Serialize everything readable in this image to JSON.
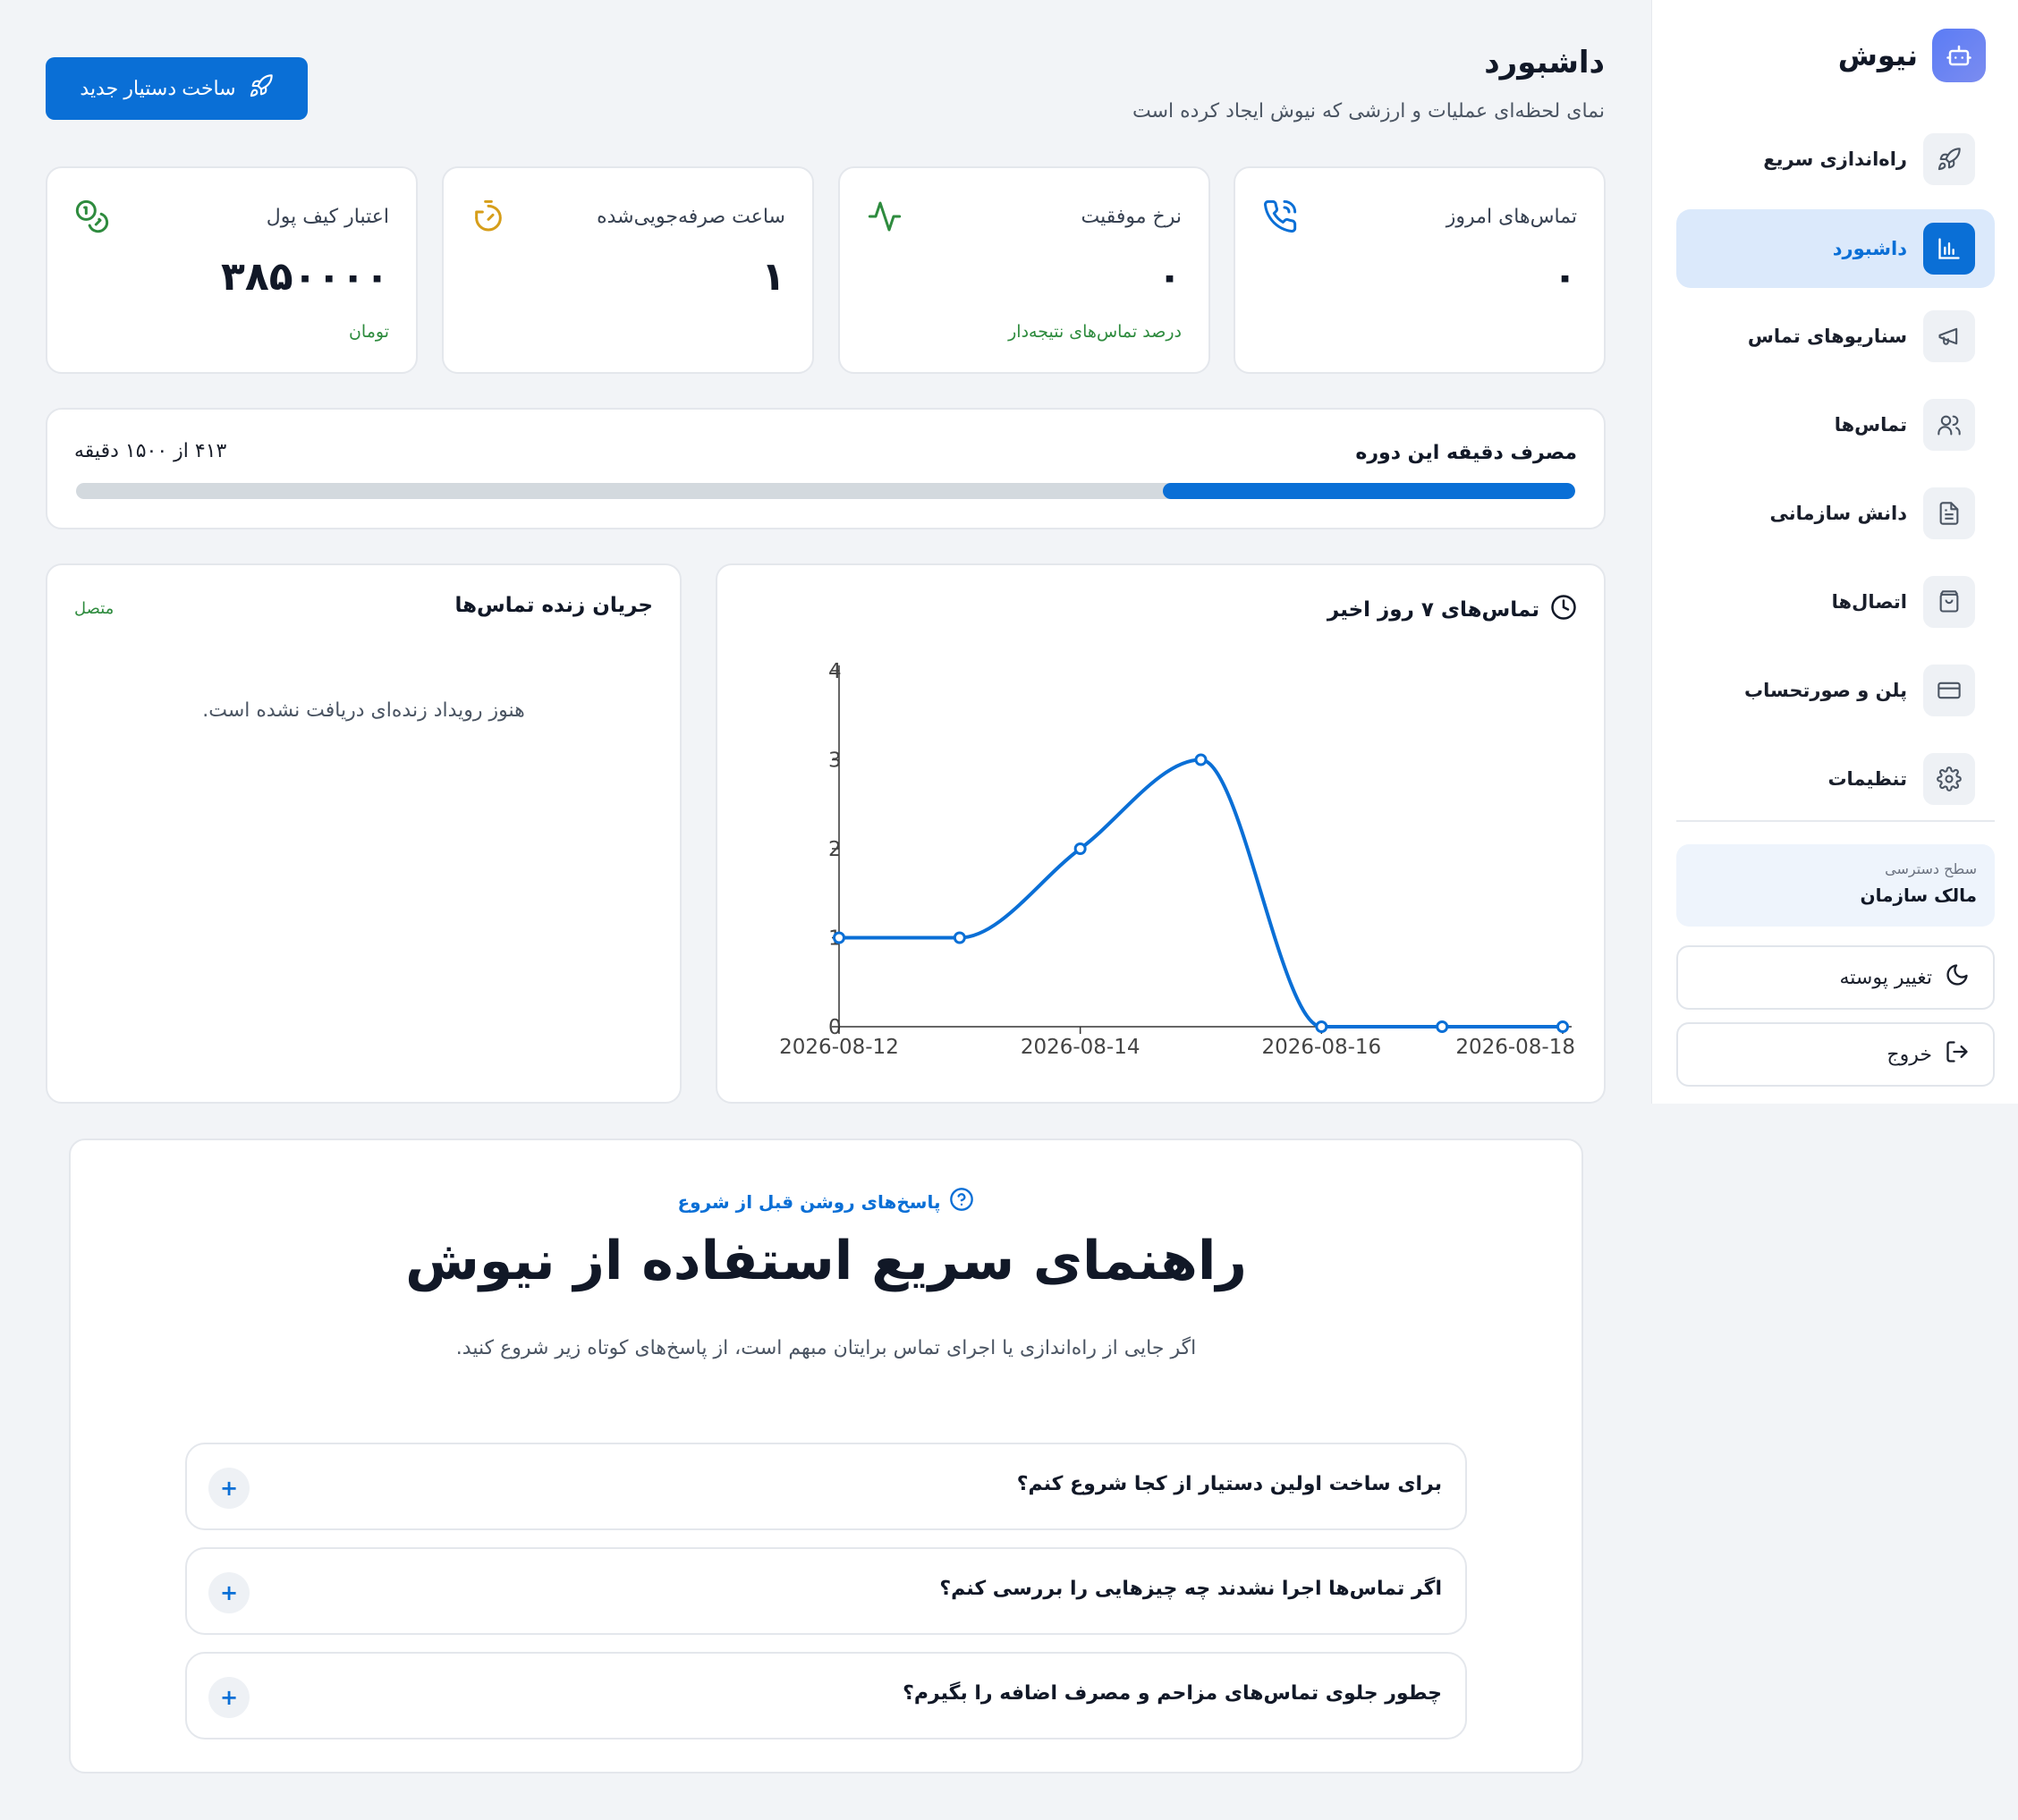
{
  "brand": {
    "name": "نیوش"
  },
  "sidebar": {
    "items": [
      {
        "label": "راه‌اندازی سریع",
        "icon": "rocket-icon",
        "active": false
      },
      {
        "label": "داشبورد",
        "icon": "bar-chart-icon",
        "active": true
      },
      {
        "label": "سناریوهای تماس",
        "icon": "megaphone-icon",
        "active": false
      },
      {
        "label": "تماس‌ها",
        "icon": "users-icon",
        "active": false
      },
      {
        "label": "دانش سازمانی",
        "icon": "document-icon",
        "active": false
      },
      {
        "label": "اتصال‌ها",
        "icon": "bag-icon",
        "active": false
      },
      {
        "label": "پلن و صورتحساب",
        "icon": "credit-card-icon",
        "active": false
      },
      {
        "label": "تنظیمات",
        "icon": "gear-icon",
        "active": false
      }
    ],
    "access": {
      "caption": "سطح دسترسی",
      "value": "مالک سازمان"
    },
    "theme_button": "تغییر پوسته",
    "logout_button": "خروج"
  },
  "header": {
    "title": "داشبورد",
    "subtitle": "نمای لحظه‌ای عملیات و ارزشی که نیوش ایجاد کرده است",
    "create_button": "ساخت دستیار جدید"
  },
  "stats": [
    {
      "title": "تماس‌های امروز",
      "value": "۰",
      "foot": "",
      "icon": "phone-icon"
    },
    {
      "title": "نرخ موفقیت",
      "value": "۰",
      "foot": "درصد تماس‌های نتیجه‌دار",
      "icon": "activity-icon"
    },
    {
      "title": "ساعت صرفه‌جویی‌شده",
      "value": "۱",
      "foot": "",
      "icon": "timer-icon"
    },
    {
      "title": "اعتبار کیف پول",
      "value": "۳۸۵۰۰۰۰",
      "foot": "تومان",
      "icon": "coins-icon"
    }
  ],
  "usage": {
    "title": "مصرف دقیقه این دوره",
    "count_text": "۴۱۳ از ۱۵۰۰ دقیقه",
    "used": 413,
    "total": 1500
  },
  "live_feed": {
    "title": "جریان زنده تماس‌ها",
    "status": "متصل",
    "empty_text": "هنوز رویداد زنده‌ای دریافت نشده است."
  },
  "chart_panel": {
    "title": "تماس‌های ۷ روز اخیر"
  },
  "chart_data": {
    "type": "line",
    "title": "تماس‌های ۷ روز اخیر",
    "x": [
      "2026-08-12",
      "2026-08-13",
      "2026-08-14",
      "2026-08-15",
      "2026-08-16",
      "2026-08-17",
      "2026-08-18"
    ],
    "x_tick_labels": [
      "2026-08-12",
      "2026-08-14",
      "2026-08-16",
      "2026-08-18"
    ],
    "values": [
      1,
      1,
      2,
      3,
      0,
      0,
      0
    ],
    "y_ticks": [
      "0",
      "1",
      "2",
      "3",
      "4"
    ],
    "ylim": [
      0,
      4
    ],
    "color": "#0a6fd6",
    "smooth": true,
    "grid": false
  },
  "guide": {
    "badge": "پاسخ‌های روشن قبل از شروع",
    "title": "راهنمای سریع استفاده از نیوش",
    "subtitle": "اگر جایی از راه‌اندازی یا اجرای تماس برایتان مبهم است، از پاسخ‌های کوتاه زیر شروع کنید.",
    "faqs": [
      {
        "question": "برای ساخت اولین دستیار از کجا شروع کنم؟",
        "toggle": "+"
      },
      {
        "question": "اگر تماس‌ها اجرا نشدند چه چیزهایی را بررسی کنم؟",
        "toggle": "+"
      },
      {
        "question": "چطور جلوی تماس‌های مزاحم و مصرف اضافه را بگیرم؟",
        "toggle": "+"
      }
    ]
  },
  "colors": {
    "primary": "#0a6fd6",
    "success": "#2e8b3e",
    "warning": "#d69e1a",
    "active_bg": "#dbe9fb"
  }
}
